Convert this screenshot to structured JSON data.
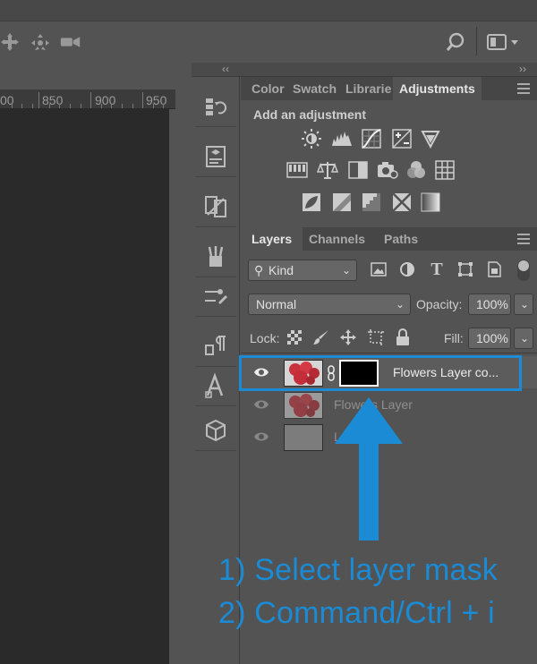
{
  "ruler": {
    "labels": [
      "00",
      "850",
      "900",
      "950"
    ]
  },
  "panel_tabs": {
    "color": "Color",
    "swatches": "Swatch",
    "libraries": "Librarie",
    "adjustments": "Adjustments"
  },
  "adjustments": {
    "title": "Add an adjustment",
    "row1": [
      "brightness-contrast-icon",
      "levels-icon",
      "curves-icon",
      "exposure-icon",
      "vibrance-icon"
    ],
    "row2": [
      "hue-saturation-icon",
      "color-balance-icon",
      "black-white-icon",
      "photo-filter-icon",
      "channel-mixer-icon",
      "color-lookup-icon"
    ],
    "row3": [
      "invert-icon",
      "posterize-icon",
      "threshold-icon",
      "selective-color-icon",
      "gradient-map-icon"
    ]
  },
  "layers_tabs": {
    "layers": "Layers",
    "channels": "Channels",
    "paths": "Paths"
  },
  "filter": {
    "kind": "Kind"
  },
  "blend": {
    "mode": "Normal",
    "opacity_label": "Opacity:",
    "opacity_value": "100%"
  },
  "lock": {
    "label": "Lock:",
    "fill_label": "Fill:",
    "fill_value": "100%"
  },
  "layers": [
    {
      "name": "Flowers Layer co...",
      "selected": true
    },
    {
      "name": "Flowers Layer",
      "selected": false
    },
    {
      "name": "L",
      "selected": false
    }
  ],
  "annotation": {
    "line1": "1) Select layer mask",
    "line2": "2) Command/Ctrl + i",
    "color": "#1a8bd4"
  }
}
